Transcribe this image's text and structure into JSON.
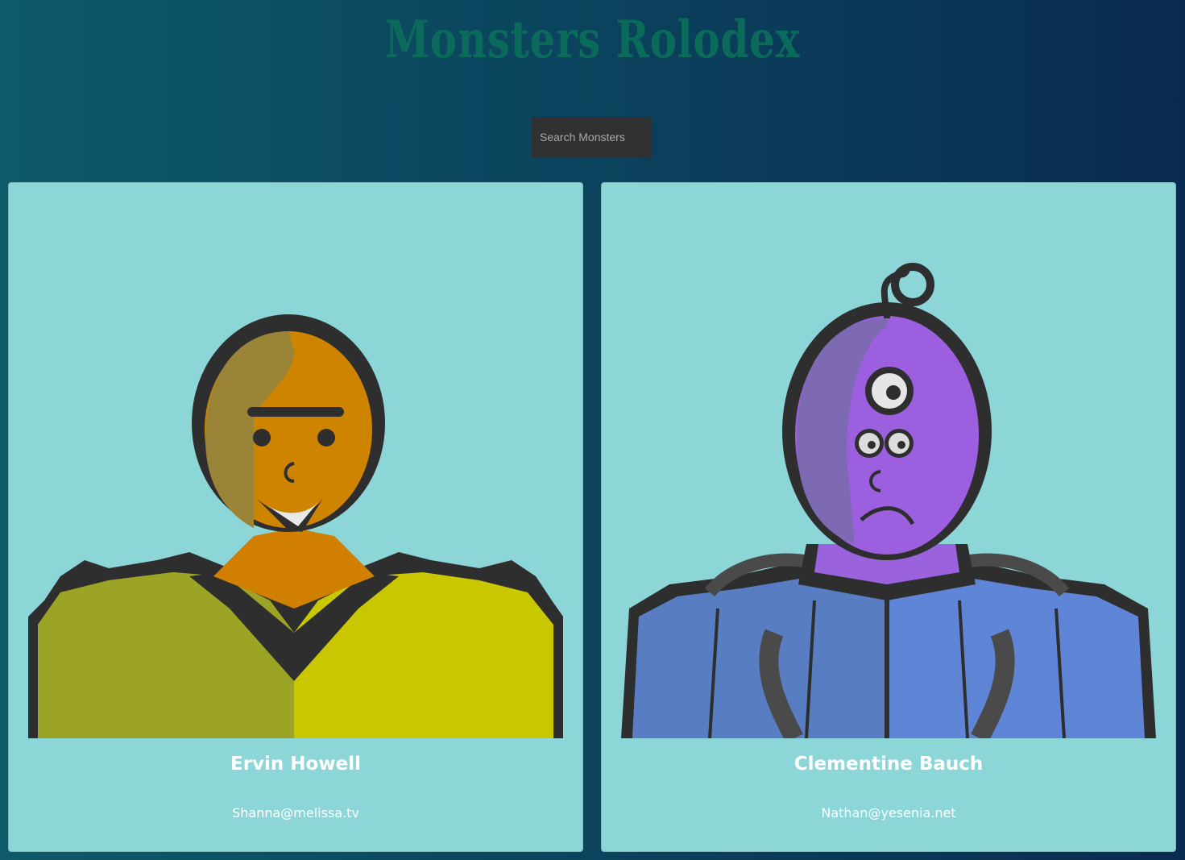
{
  "header": {
    "title": "Monsters Rolodex"
  },
  "search": {
    "placeholder": "Search Monsters"
  },
  "monsters": [
    {
      "name": "Ervin Howell",
      "email": "Shanna@melissa.tv",
      "avatar_icon": "yellow-monster-avatar"
    },
    {
      "name": "Clementine Bauch",
      "email": "Nathan@yesenia.net",
      "avatar_icon": "purple-robot-monster-avatar"
    }
  ],
  "colors": {
    "background_start": "#0c5a6a",
    "background_end": "#0a2b50",
    "title": "#0b6b5a",
    "card": "#8dd6d8",
    "search_bg": "#2f3133"
  }
}
